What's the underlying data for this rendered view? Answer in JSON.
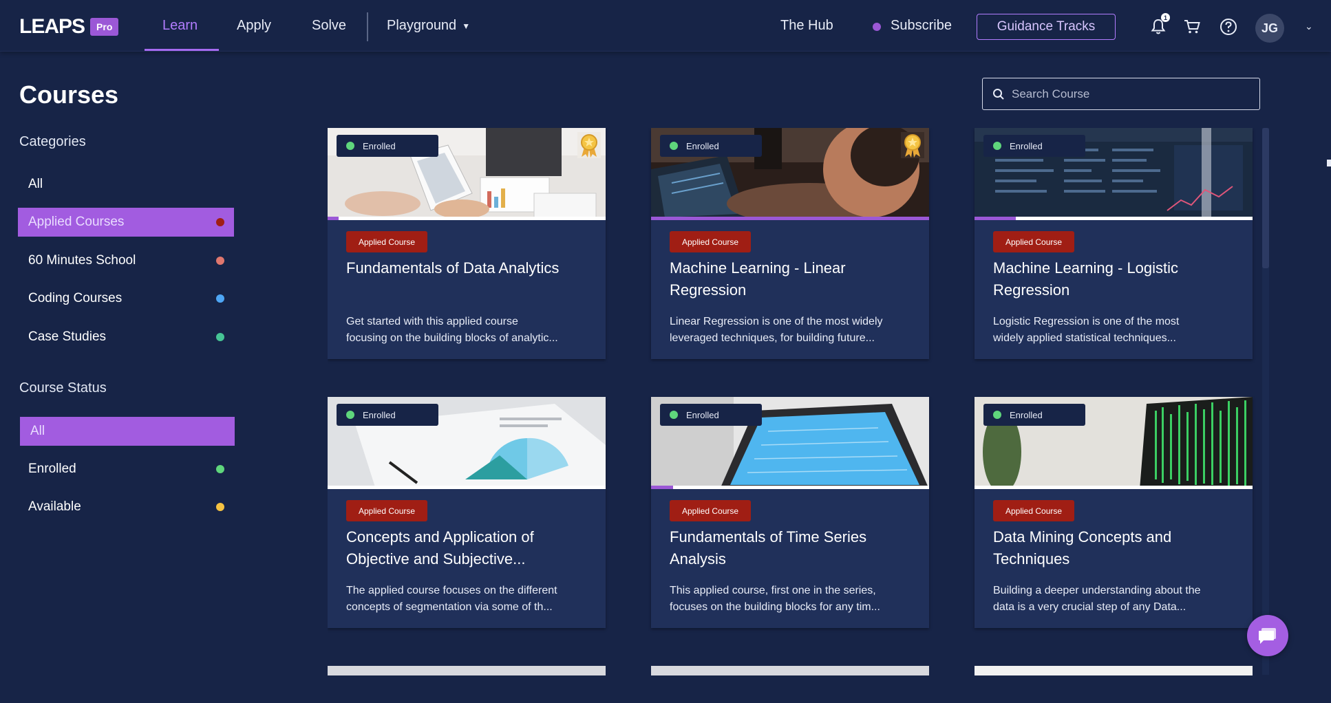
{
  "brand": {
    "name": "LEAPS",
    "badge": "Pro"
  },
  "nav": {
    "links": [
      "Learn",
      "Apply",
      "Solve",
      "Playground"
    ],
    "active": "Learn",
    "hub": "The Hub",
    "subscribe": "Subscribe",
    "guidance": "Guidance Tracks",
    "notification_count": "1",
    "user_initials": "JG"
  },
  "sidebar": {
    "title": "Courses",
    "categories_label": "Categories",
    "categories": [
      {
        "label": "All",
        "dot": null,
        "selected": false
      },
      {
        "label": "Applied Courses",
        "dot": "#a01e14",
        "selected": true
      },
      {
        "label": "60 Minutes School",
        "dot": "#e0776e",
        "selected": false
      },
      {
        "label": "Coding Courses",
        "dot": "#4ea6f5",
        "selected": false
      },
      {
        "label": "Case Studies",
        "dot": "#46c495",
        "selected": false
      }
    ],
    "status_label": "Course Status",
    "statuses": [
      {
        "label": "All",
        "dot": null,
        "selected": true
      },
      {
        "label": "Enrolled",
        "dot": "#5fd67c",
        "selected": false
      },
      {
        "label": "Available",
        "dot": "#f5c242",
        "selected": false
      }
    ]
  },
  "search": {
    "placeholder": "Search Course"
  },
  "courses": [
    {
      "status": "Enrolled",
      "tag": "Applied Course",
      "awarded": true,
      "progress": 0.04,
      "title_lines": [
        "Fundamentals of Data Analytics"
      ],
      "desc_lines": [
        "Get started with this applied course",
        "focusing on the building blocks of analytic..."
      ]
    },
    {
      "status": "Enrolled",
      "tag": "Applied Course",
      "awarded": true,
      "progress": 1.0,
      "title_lines": [
        "Machine Learning - Linear",
        "Regression"
      ],
      "desc_lines": [
        "Linear Regression is one of the most widely",
        "leveraged techniques, for building future..."
      ]
    },
    {
      "status": "Enrolled",
      "tag": "Applied Course",
      "awarded": false,
      "progress": 0.15,
      "title_lines": [
        "Machine Learning - Logistic",
        "Regression"
      ],
      "desc_lines": [
        "Logistic Regression is one of the most",
        "widely applied statistical techniques..."
      ]
    },
    {
      "status": "Enrolled",
      "tag": "Applied Course",
      "awarded": false,
      "progress": 0.0,
      "title_lines": [
        "Concepts and Application of",
        "Objective and Subjective..."
      ],
      "desc_lines": [
        "The applied course focuses on the different",
        "concepts of segmentation via some of th..."
      ]
    },
    {
      "status": "Enrolled",
      "tag": "Applied Course",
      "awarded": false,
      "progress": 0.08,
      "title_lines": [
        "Fundamentals of Time Series",
        "Analysis"
      ],
      "desc_lines": [
        "This applied course, first one in the series,",
        "focuses on the building blocks for any tim..."
      ]
    },
    {
      "status": "Enrolled",
      "tag": "Applied Course",
      "awarded": false,
      "progress": 0.0,
      "title_lines": [
        "Data Mining Concepts and",
        "Techniques"
      ],
      "desc_lines": [
        "Building a deeper understanding about the",
        "data is a very crucial step of any Data..."
      ]
    }
  ],
  "colors": {
    "background": "#172447",
    "card": "#20305a",
    "accent": "#9b58d6",
    "tag": "#a01e14",
    "enrolled": "#5fd67c"
  }
}
